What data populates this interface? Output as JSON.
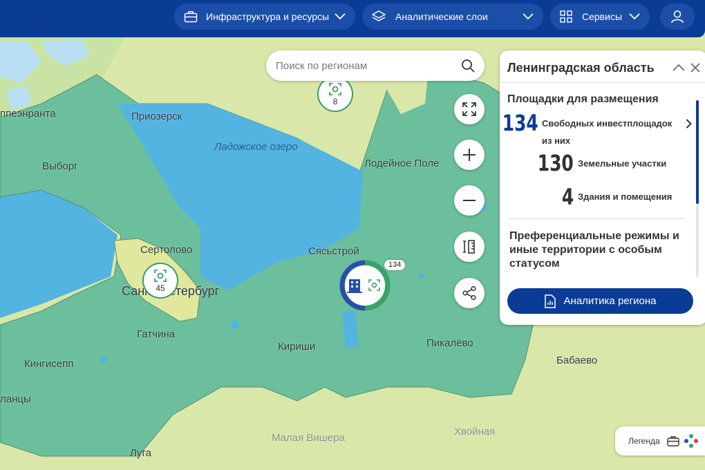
{
  "nav": {
    "items": [
      {
        "label": "Инфраструктура и ресурсы",
        "icon": "briefcase-icon"
      },
      {
        "label": "Аналитические слои",
        "icon": "layers-icon"
      },
      {
        "label": "Сервисы",
        "icon": "grid-icon"
      }
    ],
    "profile_icon": "user-icon"
  },
  "search": {
    "placeholder": "Поиск по регионам"
  },
  "map_controls": [
    "fullscreen-icon",
    "zoom-in-icon",
    "zoom-out-icon",
    "ruler-icon",
    "share-icon"
  ],
  "panel": {
    "title": "Ленинградская область",
    "section_title": "Площадки для размещения",
    "free_count": "134",
    "free_label": "Свободных инвестплощадок",
    "of_them": "из них",
    "land_count": "130",
    "land_label": "Земельные участки",
    "buildings_count": "4",
    "buildings_label": "Здания и помещения",
    "preferential": "Преференциальные режимы и иные территории с особым статусом",
    "analytics_button": "Аналитика региона"
  },
  "legend": {
    "label": "Легенда"
  },
  "markers": {
    "top": "8",
    "spb": "45",
    "cluster": "134"
  },
  "places": {
    "laplapenranta": "ппеэнранта",
    "priozersk": "Приозерск",
    "ladoga": "Ладожское озеро",
    "vyborg": "Выборг",
    "lodeinoe": "Лодейное Поле",
    "sertolovo": "Сертолово",
    "syasstroy": "Сясьстрой",
    "spb": "Санкт-Петербург",
    "gatchina": "Гатчина",
    "kirishi": "Кириши",
    "pikalevo": "Пикалёво",
    "kingisepp": "Кингисепп",
    "babaevo": "Бабаево",
    "slantsy": "ланцы",
    "malaya_vishera": "Малая Вишера",
    "khvoinaya": "Хвойная",
    "luga": "Луга"
  },
  "colors": {
    "navy": "#0a3c96",
    "region": "#6cbf9c",
    "water": "#53b4e2",
    "land": "#d9e8a8",
    "spb": "#dfe89c"
  }
}
